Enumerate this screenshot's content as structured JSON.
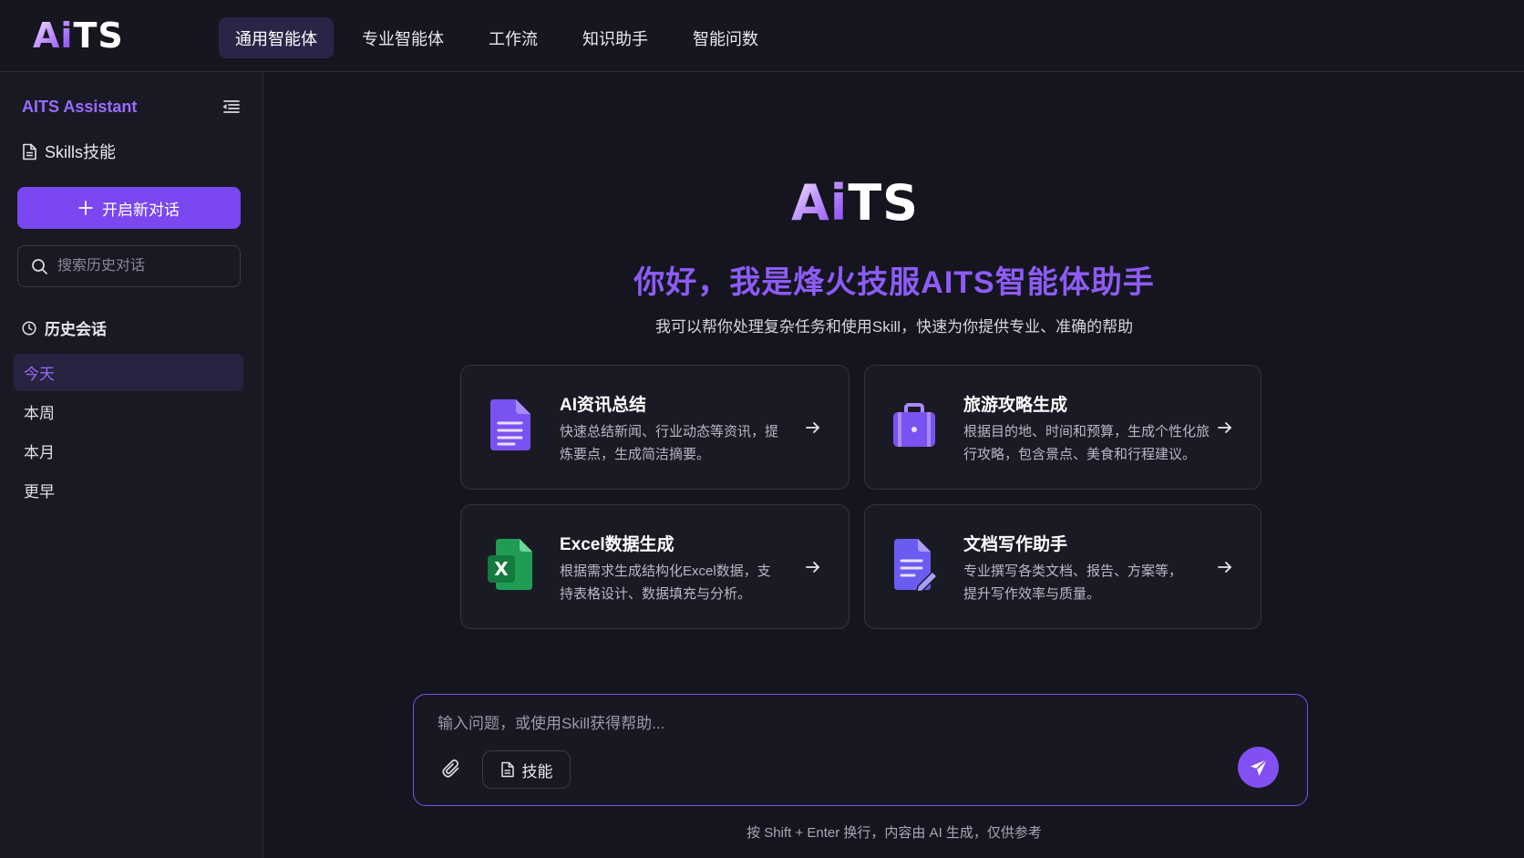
{
  "brand": {
    "logo_ai": "Ai",
    "logo_ts": "TS"
  },
  "nav": {
    "items": [
      {
        "label": "通用智能体",
        "active": true
      },
      {
        "label": "专业智能体",
        "active": false
      },
      {
        "label": "工作流",
        "active": false
      },
      {
        "label": "知识助手",
        "active": false
      },
      {
        "label": "智能问数",
        "active": false
      }
    ]
  },
  "sidebar": {
    "title": "AITS Assistant",
    "skills_label": "Skills技能",
    "new_chat_label": "开启新对话",
    "search_placeholder": "搜索历史对话",
    "history_title": "历史会话",
    "history": [
      {
        "label": "今天",
        "active": true
      },
      {
        "label": "本周",
        "active": false
      },
      {
        "label": "本月",
        "active": false
      },
      {
        "label": "更早",
        "active": false
      }
    ]
  },
  "main": {
    "hero_title": "你好，我是烽火技服AITS智能体助手",
    "hero_subtitle": "我可以帮你处理复杂任务和使用Skill，快速为你提供专业、准确的帮助",
    "cards": [
      {
        "title": "AI资讯总结",
        "desc": "快速总结新闻、行业动态等资讯，提炼要点，生成简洁摘要。",
        "icon": "document-icon"
      },
      {
        "title": "旅游攻略生成",
        "desc": "根据目的地、时间和预算，生成个性化旅行攻略，包含景点、美食和行程建议。",
        "icon": "suitcase-icon"
      },
      {
        "title": "Excel数据生成",
        "desc": "根据需求生成结构化Excel数据，支持表格设计、数据填充与分析。",
        "icon": "excel-icon"
      },
      {
        "title": "文档写作助手",
        "desc": "专业撰写各类文档、报告、方案等，提升写作效率与质量。",
        "icon": "document-edit-icon"
      }
    ],
    "composer": {
      "placeholder": "输入问题，或使用Skill获得帮助...",
      "value": "",
      "skill_label": "技能"
    },
    "footnote": "按 Shift + Enter 换行，内容由 AI 生成，仅供参考"
  },
  "colors": {
    "accent": "#7a47f0",
    "title_purple": "#8d5cf6",
    "background": "#15151f",
    "excel_green": "#1f9d55"
  }
}
